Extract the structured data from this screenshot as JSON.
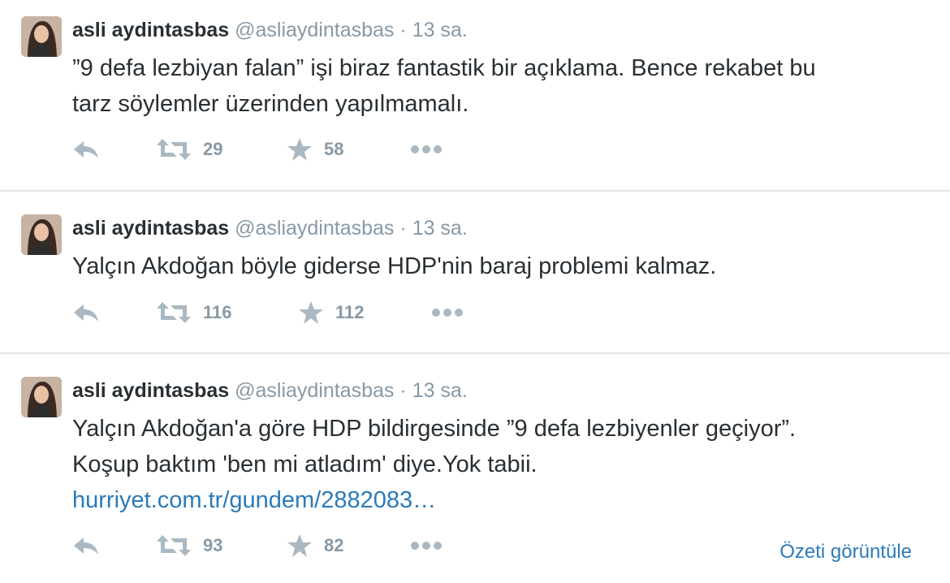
{
  "colors": {
    "name": "#292f33",
    "meta": "#8899a6",
    "link": "#2b7bb9",
    "icon": "#aab8c2",
    "divider": "#e1e8ed"
  },
  "tweets": [
    {
      "name": "asli aydintasbas",
      "handle": "@asliaydintasbas",
      "separator": "·",
      "time": "13 sa.",
      "lines": [
        "”9 defa lezbiyan falan” işi biraz fantastik bir açıklama. Bence rekabet bu",
        "tarz söylemler üzerinden yapılmamalı."
      ],
      "retweets": "29",
      "favorites": "58"
    },
    {
      "name": "asli aydintasbas",
      "handle": "@asliaydintasbas",
      "separator": "·",
      "time": "13 sa.",
      "lines": [
        "Yalçın Akdoğan böyle giderse HDP'nin baraj problemi kalmaz."
      ],
      "retweets": "116",
      "favorites": "112"
    },
    {
      "name": "asli aydintasbas",
      "handle": "@asliaydintasbas",
      "separator": "·",
      "time": "13 sa.",
      "lines": [
        "Yalçın Akdoğan'a göre HDP bildirgesinde ”9 defa lezbiyenler geçiyor”.",
        "Koşup baktım 'ben mi atladım' diye.Yok tabii."
      ],
      "link": "hurriyet.com.tr/gundem/2882083…",
      "retweets": "93",
      "favorites": "82",
      "summary_label": "Özeti görüntüle"
    }
  ],
  "icons": {
    "reply": "reply-icon",
    "retweet": "retweet-icon",
    "favorite": "star-icon",
    "more": "more-icon"
  }
}
